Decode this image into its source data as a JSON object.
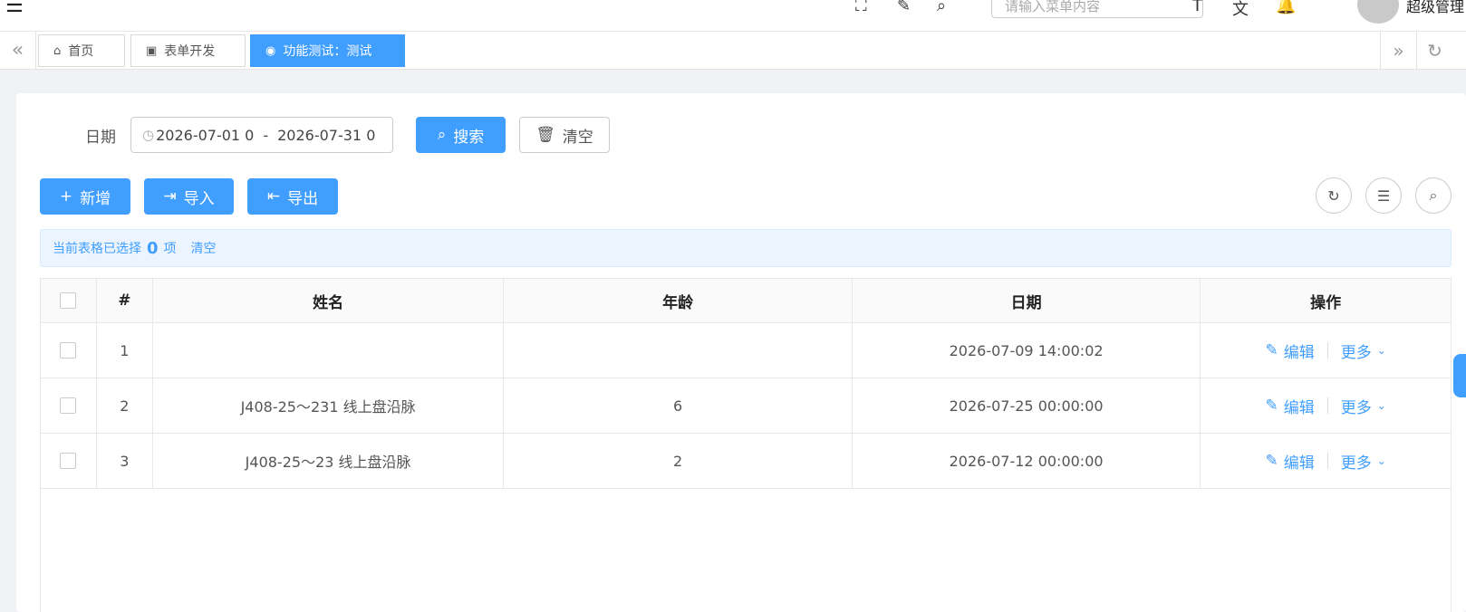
{
  "header": {
    "menu_search_placeholder": "请输入菜单内容",
    "user_name": "超级管理"
  },
  "tags": [
    {
      "label": "首页"
    },
    {
      "label": "表单开发"
    },
    {
      "label": "功能测试：测试"
    }
  ],
  "filter": {
    "date_label": "日期",
    "date_start": "2026-07-01 0",
    "date_separator": "-",
    "date_end": "2026-07-31 0",
    "search_label": "搜索",
    "clear_label": "清空"
  },
  "toolbar": {
    "add_label": "新增",
    "import_label": "导入",
    "export_label": "导出"
  },
  "selection_alert": {
    "prefix": "当前表格已选择",
    "count": "0",
    "suffix": "项",
    "clear_label": "清空"
  },
  "table": {
    "headers": [
      "#",
      "姓名",
      "年龄",
      "日期",
      "操作"
    ],
    "rows": [
      {
        "num": "1",
        "name": "",
        "age": "",
        "date": "2026-07-09 14:00:02"
      },
      {
        "num": "2",
        "name": "J408-25～231 线上盘沿脉",
        "age": "6",
        "date": "2026-07-25 00:00:00"
      },
      {
        "num": "3",
        "name": "J408-25～23 线上盘沿脉",
        "age": "2",
        "date": "2026-07-12 00:00:00"
      }
    ],
    "edit_label": "编辑",
    "more_label": "更多"
  },
  "colors": {
    "primary": "#409eff",
    "alert_bg": "#ecf5ff"
  }
}
